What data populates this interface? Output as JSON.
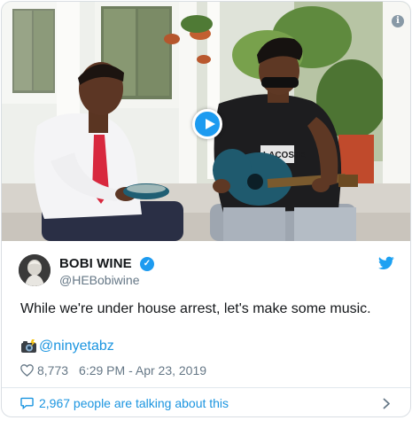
{
  "tweet": {
    "author_name": "BOBI WINE",
    "author_handle": "@HEBobiwine",
    "text": "While we're under house arrest, let's make some music.",
    "credit_mention": "@ninyetabz",
    "likes": "8,773",
    "timestamp": "6:29 PM - Apr 23, 2019",
    "talking": "2,967 people are talking about this",
    "verified": true
  },
  "media": {
    "type": "video",
    "shirt_print": "LACOSTE",
    "play_icon": "play-icon",
    "info_icon": "i"
  },
  "icons": {
    "verified": "✓",
    "camera": "camera-flash-icon",
    "heart": "heart-icon",
    "bubble": "speech-bubble-icon",
    "chevron": "chevron-right-icon",
    "bird": "twitter-bird-icon"
  },
  "colors": {
    "link": "#1b95e0",
    "brand": "#1d9bf0",
    "muted": "#657786",
    "text": "#14171a"
  }
}
